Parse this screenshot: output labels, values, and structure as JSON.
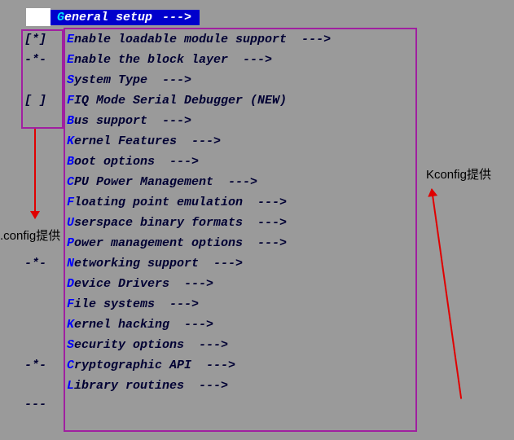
{
  "header": {
    "hot": "G",
    "rest": "eneral setup",
    "arrow": "--->"
  },
  "items": [
    {
      "ind": "[*]",
      "hot": "E",
      "rest": "nable loadable module support  --->"
    },
    {
      "ind": "-*-",
      "hot": "E",
      "rest": "nable the block layer  --->"
    },
    {
      "ind": "",
      "hot": "S",
      "rest": "ystem Type  --->"
    },
    {
      "ind": "[ ]",
      "hot": "F",
      "rest": "IQ Mode Serial Debugger (NEW)"
    },
    {
      "ind": "",
      "hot": "B",
      "rest": "us support  --->"
    },
    {
      "ind": "",
      "hot": "K",
      "rest": "ernel Features  --->"
    },
    {
      "ind": "",
      "hot": "B",
      "rest": "oot options  --->"
    },
    {
      "ind": "",
      "hot": "C",
      "rest": "PU Power Management  --->"
    },
    {
      "ind": "",
      "hot": "F",
      "rest": "loating point emulation  --->"
    },
    {
      "ind": "",
      "hot": "U",
      "rest": "serspace binary formats  --->"
    },
    {
      "ind": "",
      "hot": "P",
      "rest": "ower management options  --->"
    },
    {
      "ind": "-*-",
      "hot": "N",
      "rest": "etworking support  --->"
    },
    {
      "ind": "",
      "hot": "D",
      "rest": "evice Drivers  --->"
    },
    {
      "ind": "",
      "hot": "F",
      "rest": "ile systems  --->"
    },
    {
      "ind": "",
      "hot": "K",
      "rest": "ernel hacking  --->"
    },
    {
      "ind": "",
      "hot": "S",
      "rest": "ecurity options  --->"
    },
    {
      "ind": "-*-",
      "hot": "C",
      "rest": "ryptographic API  --->"
    },
    {
      "ind": "",
      "hot": "L",
      "rest": "ibrary routines  --->"
    }
  ],
  "footer": "---",
  "annotations": {
    "left": ".config提供",
    "right": "Kconfig提供"
  }
}
